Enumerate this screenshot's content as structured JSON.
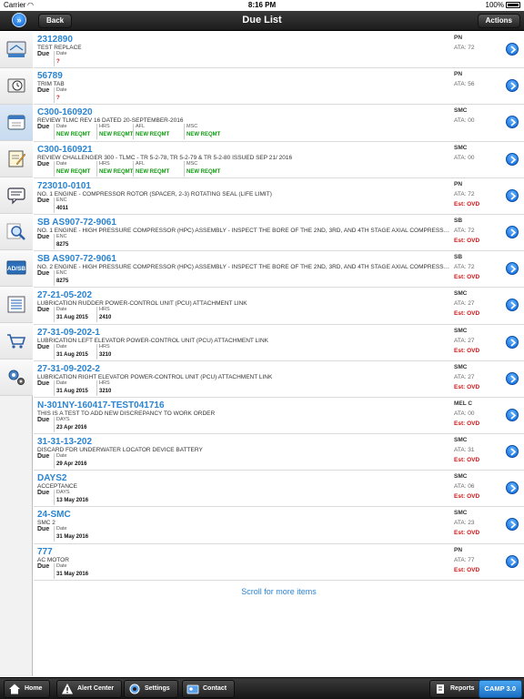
{
  "status_bar": {
    "carrier": "Carrier",
    "time": "8:16 PM",
    "battery": "100%"
  },
  "navbar": {
    "back_label": "Back",
    "title": "Due List",
    "actions_label": "Actions"
  },
  "sidebar": {
    "items": [
      {
        "icon": "overview-icon"
      },
      {
        "icon": "aircraft-time-icon"
      },
      {
        "icon": "calendar-icon"
      },
      {
        "icon": "task-edit-icon"
      },
      {
        "icon": "message-icon"
      },
      {
        "icon": "search-icon"
      },
      {
        "icon": "ad-sb-icon"
      },
      {
        "icon": "list-icon"
      },
      {
        "icon": "cart-icon"
      },
      {
        "icon": "settings-gear-icon"
      }
    ],
    "ad_sb_label": "AD/SB",
    "overview_label": "Overview"
  },
  "list": {
    "rows": [
      {
        "title": "2312890",
        "desc": "TEST REPLACE",
        "due": "Due",
        "cols": [
          {
            "h": "Date",
            "v": "?",
            "style": "red"
          }
        ],
        "type": "PN",
        "ata": "ATA: 72",
        "est": ""
      },
      {
        "title": "56789",
        "desc": "TRIM TAB",
        "due": "Due",
        "cols": [
          {
            "h": "Date",
            "v": "?",
            "style": "red"
          }
        ],
        "type": "PN",
        "ata": "ATA: 56",
        "est": ""
      },
      {
        "title": "C300-160920",
        "desc": "REVIEW TLMC REV 16 DATED 20-SEPTEMBER-2016",
        "due": "Due",
        "cols": [
          {
            "h": "Date",
            "v": "NEW REQMT",
            "style": "green"
          },
          {
            "h": "HRS",
            "v": "NEW REQMT",
            "style": "green"
          },
          {
            "h": "AFL",
            "v": "NEW REQMT",
            "style": "green"
          },
          {
            "h": "MSC",
            "v": "NEW REQMT",
            "style": "green"
          }
        ],
        "type": "SMC",
        "ata": "ATA: 00",
        "est": ""
      },
      {
        "title": "C300-160921",
        "desc": "REVIEW CHALLENGER 300 - TLMC - TR 5-2-78, TR 5-2-79 & TR 5-2-80 ISSUED SEP 21/ 2016",
        "due": "Due",
        "cols": [
          {
            "h": "Date",
            "v": "NEW REQMT",
            "style": "green"
          },
          {
            "h": "HRS",
            "v": "NEW REQMT",
            "style": "green"
          },
          {
            "h": "AFL",
            "v": "NEW REQMT",
            "style": "green"
          },
          {
            "h": "MSC",
            "v": "NEW REQMT",
            "style": "green"
          }
        ],
        "type": "SMC",
        "ata": "ATA: 00",
        "est": ""
      },
      {
        "title": "723010-0101",
        "desc": "NO. 1 ENGINE - COMPRESSOR ROTOR (SPACER, 2-3) ROTATING SEAL (LIFE LIMIT)",
        "due": "Due",
        "cols": [
          {
            "h": "ENC",
            "v": "4011",
            "style": ""
          }
        ],
        "type": "PN",
        "ata": "ATA: 72",
        "est": "Est: OVD"
      },
      {
        "title": "SB AS907-72-9061",
        "desc": "NO. 1 ENGINE - HIGH PRESSURE COMPRESSOR (HPC) ASSEMBLY - INSPECT THE BORE OF THE 2ND, 3RD, AND 4TH STAGE AXIAL COMPRESSOR DISKS",
        "due": "Due",
        "cols": [
          {
            "h": "ENC",
            "v": "8275",
            "style": ""
          }
        ],
        "type": "SB",
        "ata": "ATA: 72",
        "est": "Est: OVD"
      },
      {
        "title": "SB AS907-72-9061",
        "desc": "NO. 2 ENGINE - HIGH PRESSURE COMPRESSOR (HPC) ASSEMBLY - INSPECT THE BORE OF THE 2ND, 3RD, AND 4TH STAGE AXIAL COMPRESSOR DISKS",
        "due": "Due",
        "cols": [
          {
            "h": "ENC",
            "v": "8275",
            "style": ""
          }
        ],
        "type": "SB",
        "ata": "ATA: 72",
        "est": "Est: OVD"
      },
      {
        "title": "27-21-05-202",
        "desc": "LUBRICATION RUDDER POWER-CONTROL UNIT (PCU) ATTACHMENT LINK",
        "due": "Due",
        "cols": [
          {
            "h": "Date",
            "v": "31 Aug 2015",
            "style": ""
          },
          {
            "h": "HRS",
            "v": "2410",
            "style": ""
          }
        ],
        "type": "SMC",
        "ata": "ATA: 27",
        "est": "Est: OVD"
      },
      {
        "title": "27-31-09-202-1",
        "desc": "LUBRICATION LEFT ELEVATOR POWER-CONTROL UNIT (PCU) ATTACHMENT LINK",
        "due": "Due",
        "cols": [
          {
            "h": "Date",
            "v": "31 Aug 2015",
            "style": ""
          },
          {
            "h": "HRS",
            "v": "3210",
            "style": ""
          }
        ],
        "type": "SMC",
        "ata": "ATA: 27",
        "est": "Est: OVD"
      },
      {
        "title": "27-31-09-202-2",
        "desc": "LUBRICATION RIGHT ELEVATOR POWER-CONTROL UNIT (PCU) ATTACHMENT LINK",
        "due": "Due",
        "cols": [
          {
            "h": "Date",
            "v": "31 Aug 2015",
            "style": ""
          },
          {
            "h": "HRS",
            "v": "3210",
            "style": ""
          }
        ],
        "type": "SMC",
        "ata": "ATA: 27",
        "est": "Est: OVD"
      },
      {
        "title": "N-301NY-160417-TEST041716",
        "desc": "THIS IS A TEST TO ADD NEW DISCREPANCY TO WORK ORDER",
        "due": "Due",
        "cols": [
          {
            "h": "DAYS",
            "v": "23 Apr 2016",
            "style": ""
          }
        ],
        "type": "MEL C",
        "ata": "ATA: 00",
        "est": "Est: OVD"
      },
      {
        "title": "31-31-13-202",
        "desc": "DISCARD FDR UNDERWATER LOCATOR DEVICE BATTERY",
        "due": "Due",
        "cols": [
          {
            "h": "Date",
            "v": "29 Apr 2016",
            "style": ""
          }
        ],
        "type": "SMC",
        "ata": "ATA: 31",
        "est": "Est: OVD"
      },
      {
        "title": "DAYS2",
        "desc": "ACCEPTANCE",
        "due": "Due",
        "cols": [
          {
            "h": "DAYS",
            "v": "13 May 2016",
            "style": ""
          }
        ],
        "type": "SMC",
        "ata": "ATA: 06",
        "est": "Est: OVD"
      },
      {
        "title": "24-SMC",
        "desc": "SMC 2",
        "due": "Due",
        "cols": [
          {
            "h": "Date",
            "v": "31 May 2016",
            "style": ""
          }
        ],
        "type": "SMC",
        "ata": "ATA: 23",
        "est": "Est: OVD"
      },
      {
        "title": "777",
        "desc": "AC MOTOR",
        "due": "Due",
        "cols": [
          {
            "h": "Date",
            "v": "31 May 2016",
            "style": ""
          }
        ],
        "type": "PN",
        "ata": "ATA: 77",
        "est": "Est: OVD"
      }
    ],
    "more_label": "Scroll for more items"
  },
  "toolbar": {
    "home_label": "Home",
    "alert_label": "Alert Center",
    "settings_label": "Settings",
    "contact_label": "Contact",
    "reports_label": "Reports",
    "camp_label": "CAMP 3.0"
  },
  "colors": {
    "accent_blue": "#2a84d2",
    "overdue_red": "#d51313",
    "new_reqmt_green": "#119a11"
  }
}
